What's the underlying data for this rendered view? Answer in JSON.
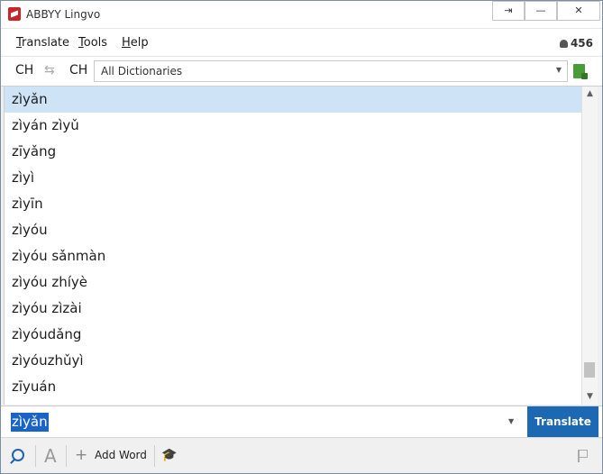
{
  "window": {
    "title": "ABBYY Lingvo"
  },
  "menu": {
    "items": [
      {
        "label": "Translate",
        "u": "T",
        "rest": "ranslate"
      },
      {
        "label": "Tools",
        "u": "T",
        "rest": "ools"
      },
      {
        "label": "Help",
        "u": "H",
        "rest": "elp"
      }
    ],
    "user_count": "456"
  },
  "langbar": {
    "source_lang": "CH",
    "target_lang": "CH",
    "dictionary": "All Dictionaries"
  },
  "wordlist": {
    "items": [
      "zìyǎn",
      "zìyán zìyǔ",
      "zīyǎng",
      "zìyì",
      "zìyīn",
      "zìyóu",
      "zìyóu sǎnmàn",
      "zìyóu zhíyè",
      "zìyóu zìzài",
      "zìyóudǎng",
      "zìyóuzhǔyì",
      "zīyuán"
    ],
    "selected_index": 0
  },
  "search": {
    "value": "zìyǎn",
    "translate_label": "Translate"
  },
  "toolbar": {
    "font_label": "A",
    "add_word_label": "Add Word"
  },
  "colors": {
    "selection": "#cfe3f6",
    "accent": "#1c68b3",
    "brand": "#c8262a"
  }
}
